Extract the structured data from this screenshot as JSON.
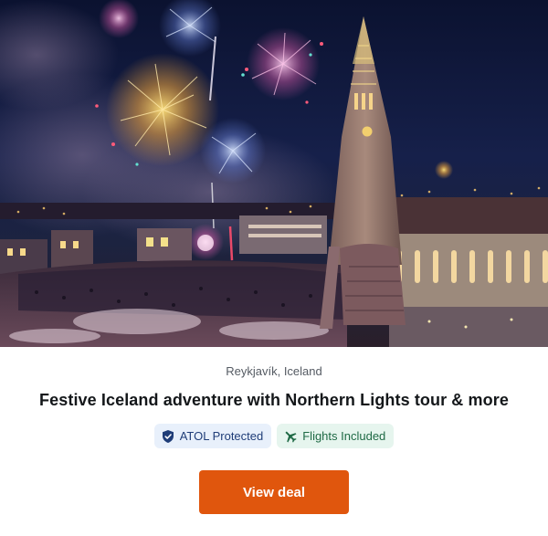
{
  "deal": {
    "image_alt": "Fireworks over Reykjavík with Hallgrímskirkja church",
    "location": "Reykjavík, Iceland",
    "title": "Festive Iceland adventure with Northern Lights tour & more",
    "badges": [
      {
        "label": "ATOL Protected",
        "icon": "shield-check-icon"
      },
      {
        "label": "Flights Included",
        "icon": "airplane-icon"
      }
    ],
    "cta_label": "View deal",
    "colors": {
      "cta": "#e0560d",
      "atol_badge_bg": "#e8f0fb",
      "atol_badge_text": "#1f3d78",
      "flight_badge_bg": "#e6f5ee",
      "flight_badge_text": "#1f6a45"
    }
  }
}
